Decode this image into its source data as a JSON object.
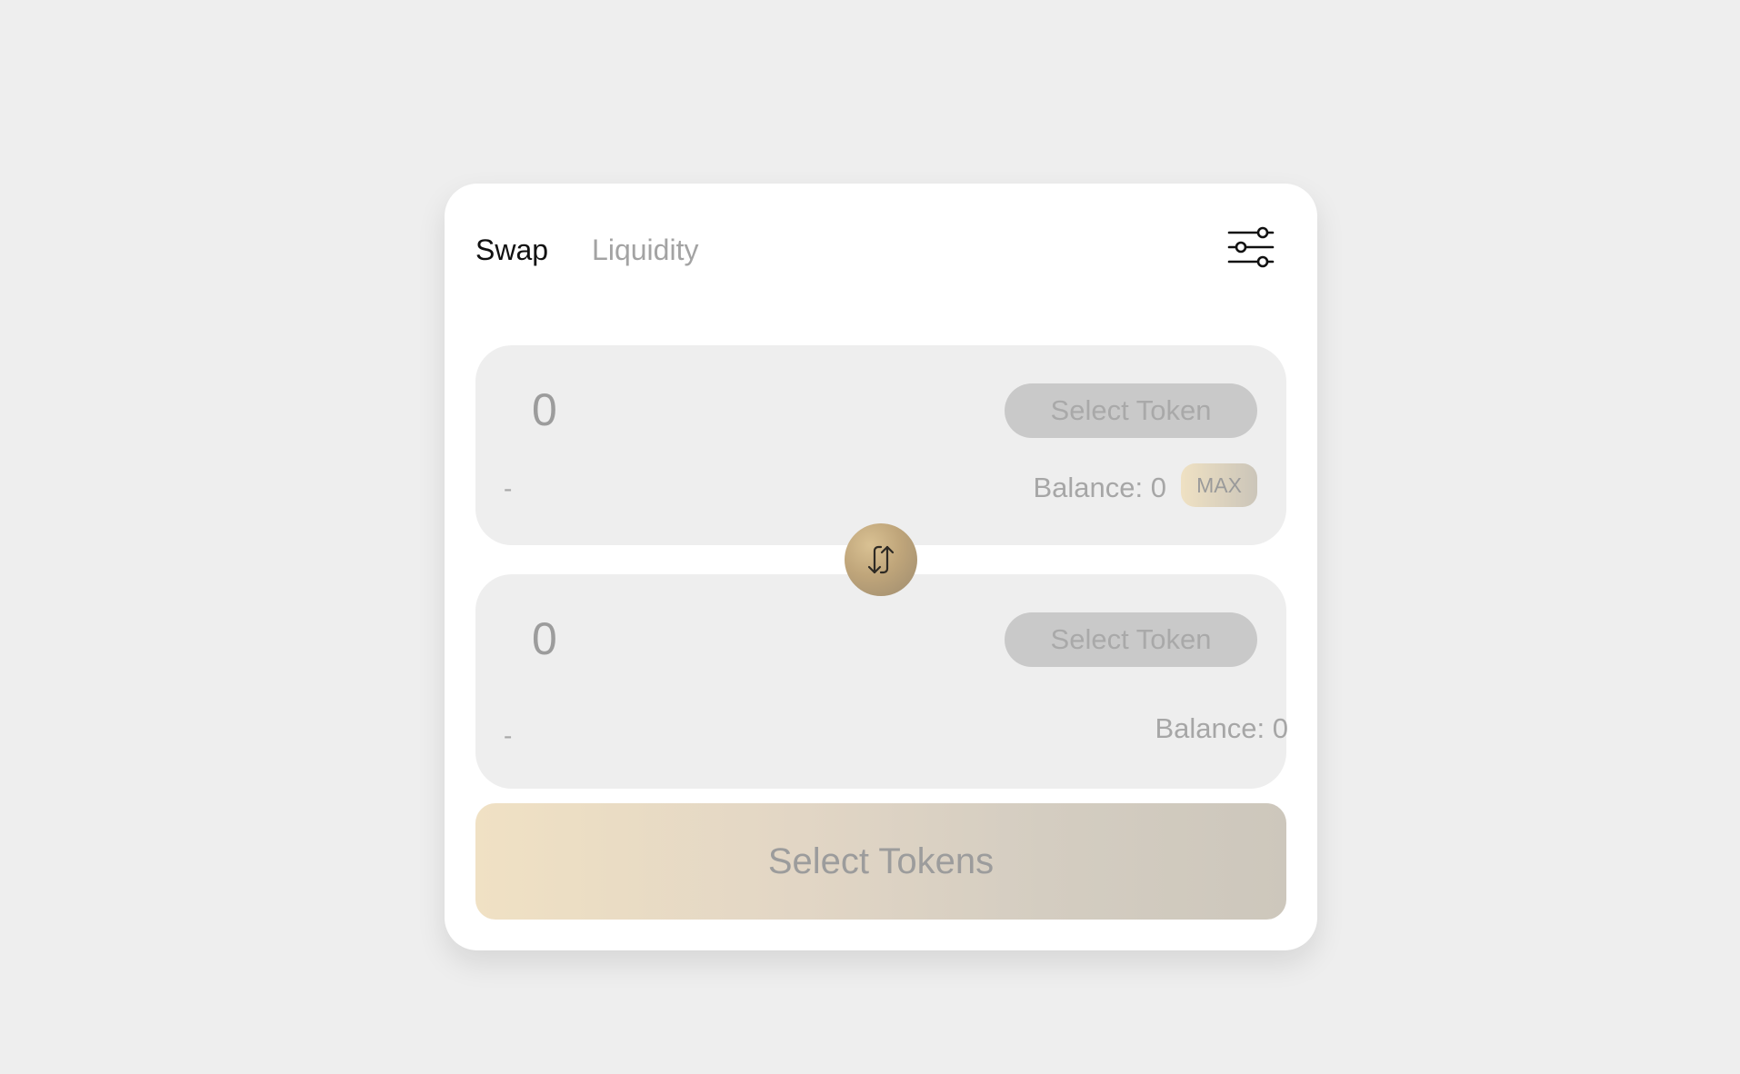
{
  "tabs": {
    "swap": "Swap",
    "liquidity": "Liquidity"
  },
  "from": {
    "amount_placeholder": "0",
    "select_label": "Select Token",
    "usd_value": "-",
    "balance": "Balance: 0",
    "max_label": "MAX"
  },
  "to": {
    "amount_placeholder": "0",
    "select_label": "Select Token",
    "usd_value": "-",
    "balance": "Balance: 0"
  },
  "action": {
    "label": "Select Tokens"
  },
  "icons": {
    "settings": "sliders-icon",
    "switch": "swap-arrows-icon"
  },
  "colors": {
    "accent_gold": "#c2a878",
    "panel_bg": "#eeeeee",
    "page_bg": "#eeeeee"
  }
}
